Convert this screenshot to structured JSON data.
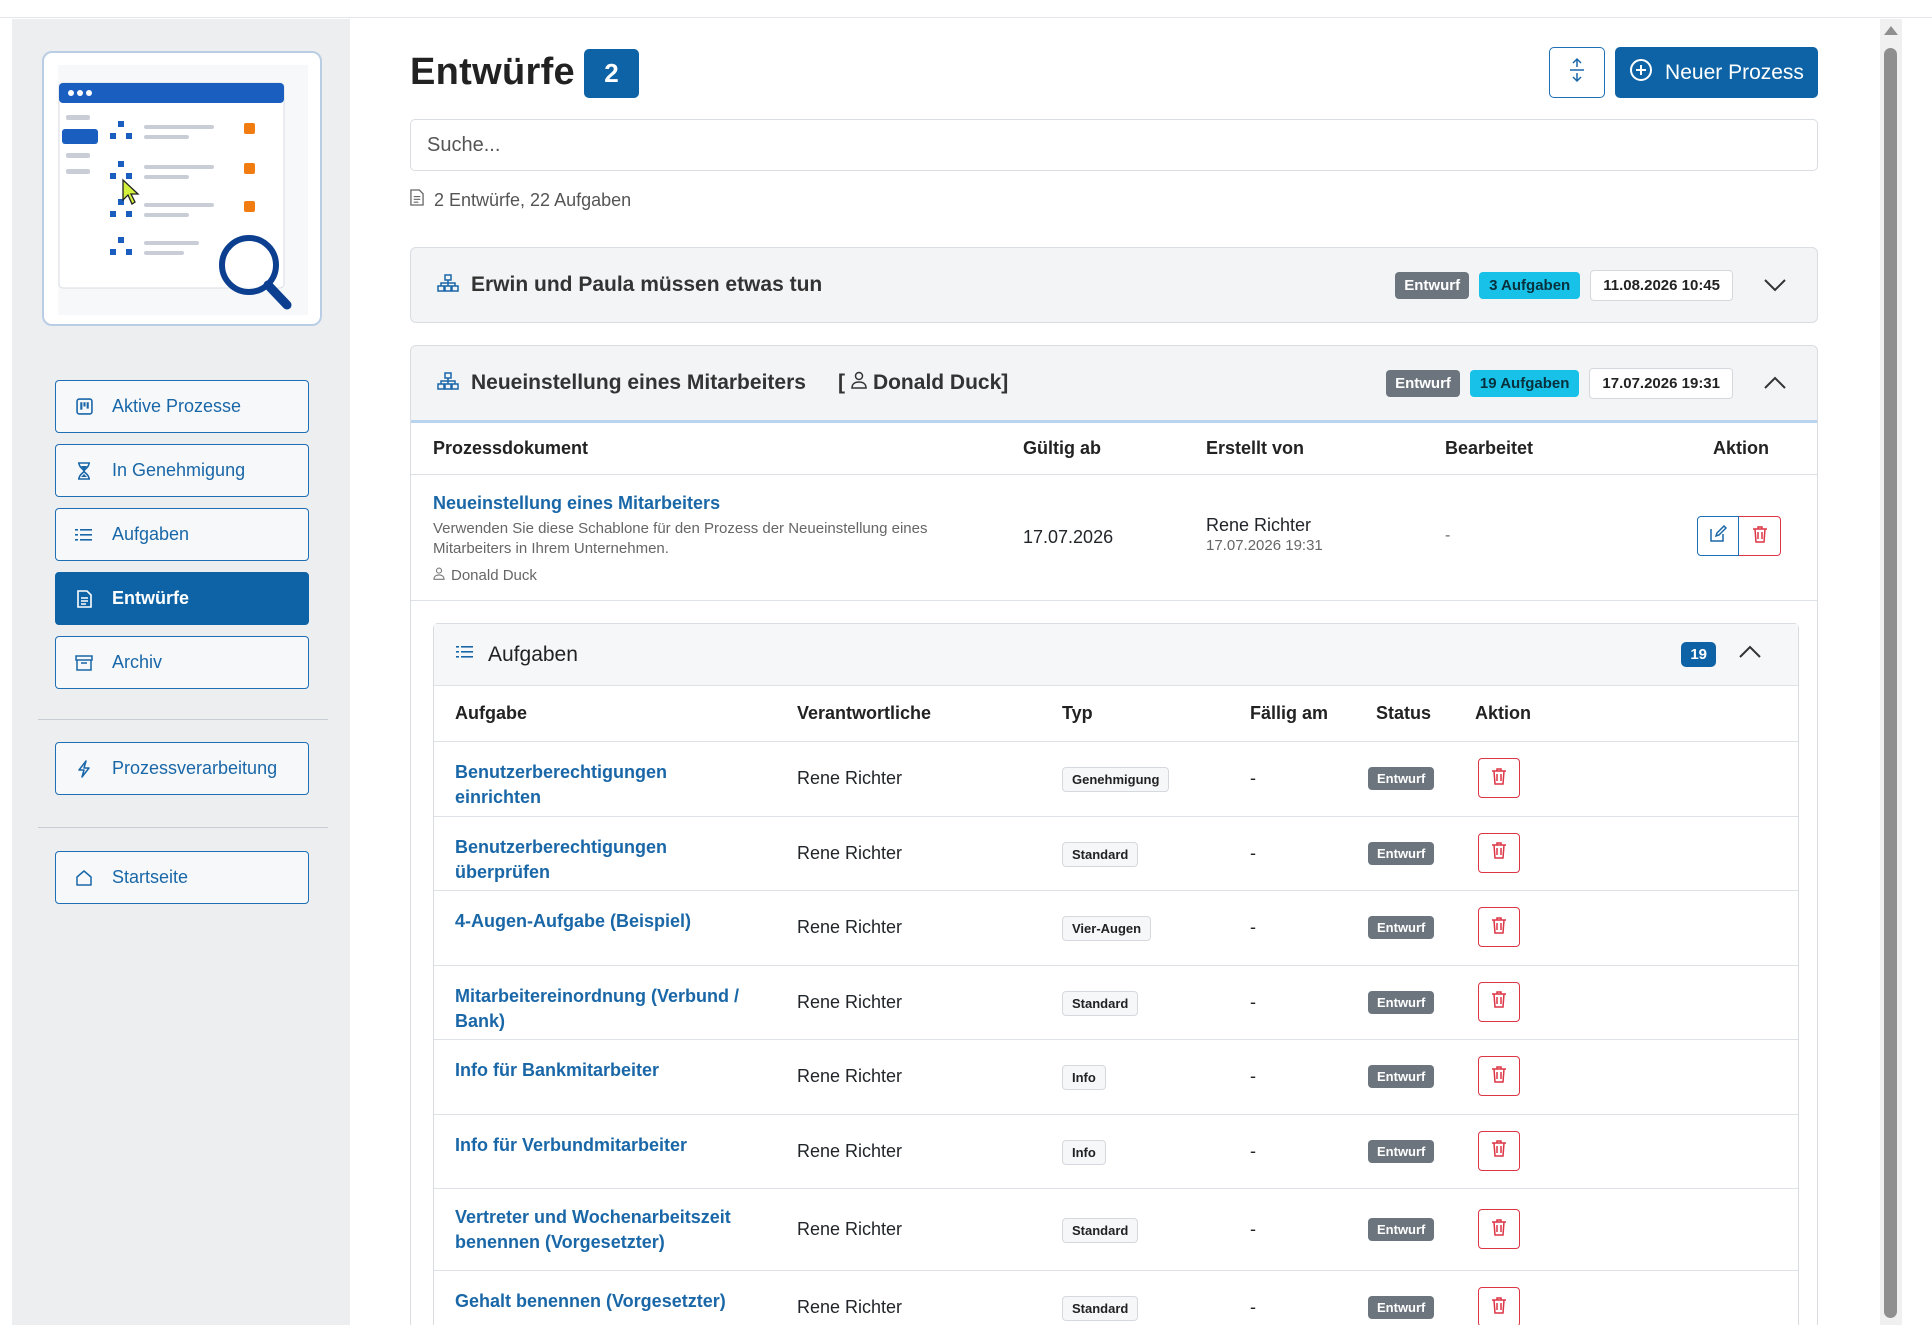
{
  "sidebar": {
    "items": [
      {
        "label": "Aktive Prozesse",
        "icon": "kanban-icon"
      },
      {
        "label": "In Genehmigung",
        "icon": "hourglass-icon"
      },
      {
        "label": "Aufgaben",
        "icon": "list-icon"
      },
      {
        "label": "Entwürfe",
        "icon": "document-icon",
        "active": true
      },
      {
        "label": "Archiv",
        "icon": "archive-icon"
      },
      {
        "label": "Prozessverarbeitung",
        "icon": "lightning-icon"
      },
      {
        "label": "Startseite",
        "icon": "house-icon"
      }
    ]
  },
  "header": {
    "title": "Entwürfe",
    "count": "2",
    "new_process_label": "Neuer Prozess"
  },
  "search": {
    "placeholder": "Suche..."
  },
  "summary": "2 Entwürfe, 22 Aufgaben",
  "processes": [
    {
      "title": "Erwin und Paula müssen etwas tun",
      "status": "Entwurf",
      "tasks_badge": "3 Aufgaben",
      "date": "11.08.2026 10:45"
    },
    {
      "title": "Neueinstellung eines Mitarbeiters",
      "owner_open": "[",
      "owner": "Donald Duck]",
      "status": "Entwurf",
      "tasks_badge": "19 Aufgaben",
      "date": "17.07.2026 19:31",
      "doc_columns": [
        "Prozessdokument",
        "Gültig ab",
        "Erstellt von",
        "Bearbeitet",
        "Aktion"
      ],
      "doc": {
        "title": "Neueinstellung eines Mitarbeiters",
        "description": "Verwenden Sie diese Schablone für den Prozess der Neueinstellung eines Mitarbeiters in Ihrem Unternehmen.",
        "owner": "Donald Duck",
        "valid_from": "17.07.2026",
        "created_by": "Rene Richter",
        "created_at": "17.07.2026 19:31",
        "edited": "-"
      },
      "tasks": {
        "title": "Aufgaben",
        "count": "19",
        "columns": [
          "Aufgabe",
          "Verantwortliche",
          "Typ",
          "Fällig am",
          "Status",
          "Aktion"
        ],
        "rows": [
          {
            "name": "Benutzerberechtigungen einrichten",
            "owner": "Rene Richter",
            "type": "Genehmigung",
            "due": "-",
            "status": "Entwurf"
          },
          {
            "name": "Benutzerberechtigungen überprüfen",
            "owner": "Rene Richter",
            "type": "Standard",
            "due": "-",
            "status": "Entwurf"
          },
          {
            "name": "4-Augen-Aufgabe (Beispiel)",
            "owner": "Rene Richter",
            "type": "Vier-Augen",
            "due": "-",
            "status": "Entwurf"
          },
          {
            "name": "Mitarbeitereinordnung (Verbund / Bank)",
            "owner": "Rene Richter",
            "type": "Standard",
            "due": "-",
            "status": "Entwurf"
          },
          {
            "name": "Info für Bankmitarbeiter",
            "owner": "Rene Richter",
            "type": "Info",
            "due": "-",
            "status": "Entwurf"
          },
          {
            "name": "Info für Verbundmitarbeiter",
            "owner": "Rene Richter",
            "type": "Info",
            "due": "-",
            "status": "Entwurf"
          },
          {
            "name": "Vertreter und Wochenarbeitszeit benennen (Vorgesetzter)",
            "owner": "Rene Richter",
            "type": "Standard",
            "due": "-",
            "status": "Entwurf"
          },
          {
            "name": "Gehalt benennen (Vorgesetzter)",
            "owner": "Rene Richter",
            "type": "Standard",
            "due": "-",
            "status": "Entwurf"
          }
        ]
      }
    }
  ],
  "colors": {
    "primary": "#0d63a5",
    "danger": "#dc3545",
    "cyan": "#17c1e8",
    "gray": "#6c757d"
  }
}
